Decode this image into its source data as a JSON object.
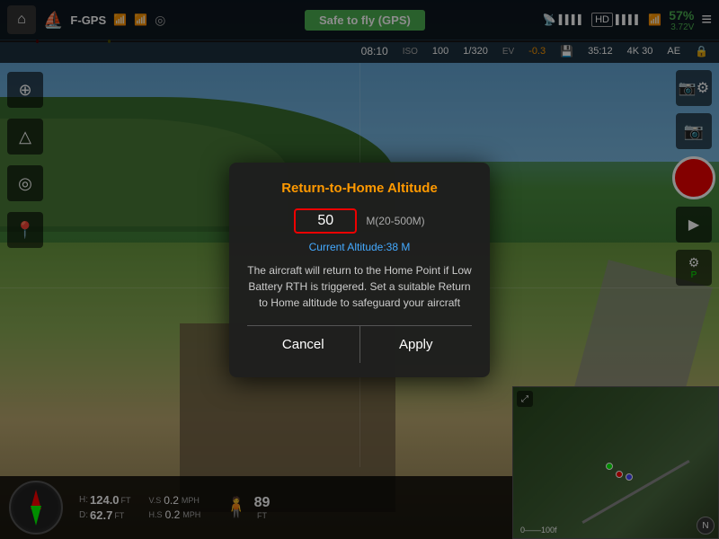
{
  "topbar": {
    "home_icon": "⌂",
    "drone_icon": "✦",
    "gps_name": "F-GPS",
    "signal_icon": "📶",
    "link_icon": "⛓",
    "status_text": "Safe to fly (GPS)",
    "hd_label": "HD",
    "battery_percent": "57%",
    "battery_voltage": "3.72V",
    "menu_icon": "≡"
  },
  "secondbar": {
    "time": "08:10",
    "iso_label": "ISO",
    "iso_value": "100",
    "shutter": "1/320",
    "ev_label": "EV",
    "ev_value": "-0.3",
    "storage": "35:12",
    "resolution": "4K 30",
    "ae_label": "AE"
  },
  "left_sidebar": {
    "icons": [
      "⊕",
      "△",
      "◎",
      "📍"
    ]
  },
  "right_sidebar": {
    "camera_settings": "⚙",
    "camera": "📷",
    "video_record": "●",
    "playback": "▶",
    "settings2": "⚙",
    "parking": "P"
  },
  "bottom_bar": {
    "height_label": "H:",
    "height_value": "124.0",
    "height_unit": "FT",
    "distance_label": "D:",
    "distance_value": "62.7",
    "distance_unit": "FT",
    "vs_label": "V.S",
    "vs_value": "0.2",
    "vs_unit": "MPH",
    "hs_label": "H.S",
    "hs_value": "0.2",
    "hs_unit": "MPH",
    "altitude_ft": "89",
    "altitude_unit": "FT"
  },
  "modal": {
    "title": "Return-to-Home Altitude",
    "altitude_value": "50",
    "altitude_range": "M(20-500M)",
    "current_altitude_label": "Current Altitude:",
    "current_altitude_value": "38 M",
    "description": "The aircraft will return to the Home Point if Low Battery RTH is triggered. Set a suitable Return to Home altitude to safeguard your aircraft",
    "cancel_label": "Cancel",
    "apply_label": "Apply"
  }
}
